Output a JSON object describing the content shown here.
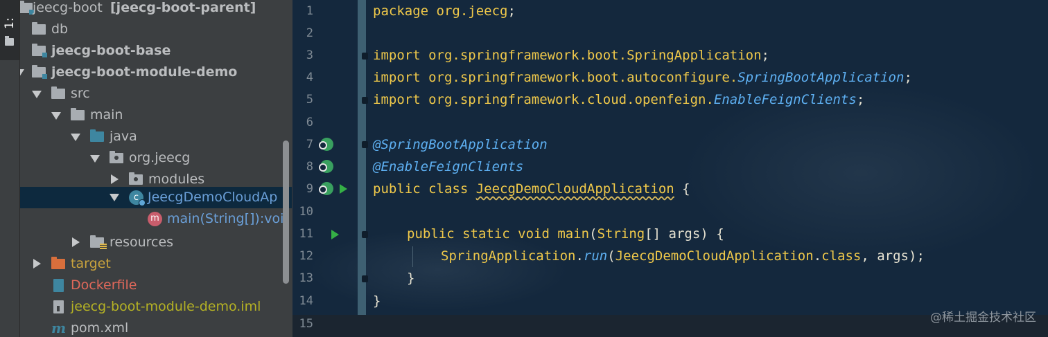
{
  "tool_window": {
    "tab_label": "1: Project"
  },
  "tree": [
    {
      "label": "jeecg-boot",
      "suffix": "[jeecg-boot-parent]"
    },
    {
      "label": "db"
    },
    {
      "label": "jeecg-boot-base"
    },
    {
      "label": "jeecg-boot-module-demo"
    },
    {
      "label": "src"
    },
    {
      "label": "main"
    },
    {
      "label": "java"
    },
    {
      "label": "org.jeecg"
    },
    {
      "label": "modules"
    },
    {
      "label": "JeecgDemoCloudAp"
    },
    {
      "label": "main(String[]):voi"
    },
    {
      "label": "resources"
    },
    {
      "label": "target"
    },
    {
      "label": "Dockerfile"
    },
    {
      "label": "jeecg-boot-module-demo.iml"
    },
    {
      "label": "pom.xml"
    }
  ],
  "editor": {
    "line_numbers": [
      "1",
      "2",
      "3",
      "4",
      "5",
      "6",
      "7",
      "8",
      "9",
      "10",
      "11",
      "12",
      "13",
      "14",
      "15"
    ],
    "code": {
      "l1": {
        "kw": "package",
        "pkg": "org.jeecg",
        "semi": ";"
      },
      "l3": {
        "kw": "import",
        "pkg": "org.springframework.boot.SpringApplication",
        "semi": ";"
      },
      "l4": {
        "kw": "import",
        "pkg": "org.springframework.boot.autoconfigure.",
        "cls": "SpringBootApplication",
        "semi": ";"
      },
      "l5": {
        "kw": "import",
        "pkg": "org.springframework.cloud.openfeign.",
        "cls": "EnableFeignClients",
        "semi": ";"
      },
      "l7": {
        "ann": "@SpringBootApplication"
      },
      "l8": {
        "ann": "@EnableFeignClients"
      },
      "l9": {
        "kw": "public class",
        "name": "JeecgDemoCloudApplication",
        "rest": " {"
      },
      "l11": {
        "kw": "public static void",
        "name": "main",
        "p1": "(",
        "type": "String",
        "p2": "[] ",
        "arg": "args",
        "p3": ") {"
      },
      "l12": {
        "cls": "SpringApplication",
        "dot": ".",
        "method": "run",
        "p1": "(",
        "cls2": "JeecgDemoCloudApplication",
        "dot2": ".",
        "kw": "class",
        "p2": ", ",
        "arg": "args",
        "p3": ");"
      },
      "l13": {
        "text": "}"
      },
      "l14": {
        "text": "}"
      }
    }
  },
  "watermark": "@稀土掘金技术社区"
}
